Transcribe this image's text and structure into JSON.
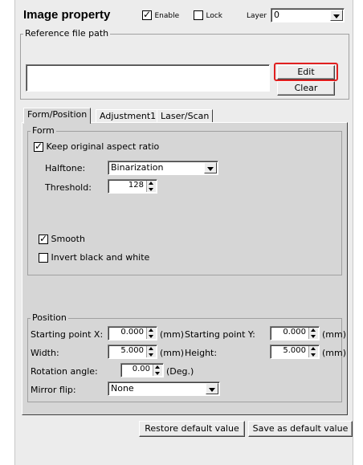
{
  "header": {
    "title": "Image property",
    "enable_label": "Enable",
    "enable_checked": true,
    "lock_label": "Lock",
    "lock_checked": false,
    "layer_label": "Layer",
    "layer_value": "0"
  },
  "reference": {
    "group_label": "Reference file path",
    "path_value": "",
    "edit_label": "Edit",
    "clear_label": "Clear"
  },
  "tabs": [
    {
      "label": "Form/Position",
      "active": true
    },
    {
      "label": "Adjustment1",
      "active": false
    },
    {
      "label": "Laser/Scan",
      "active": false
    }
  ],
  "form": {
    "group_label": "Form",
    "keep_ratio_label": "Keep original aspect ratio",
    "keep_ratio_checked": true,
    "halftone_label": "Halftone:",
    "halftone_value": "Binarization",
    "threshold_label": "Threshold:",
    "threshold_value": "128",
    "smooth_label": "Smooth",
    "smooth_checked": true,
    "invert_label": "Invert black and white",
    "invert_checked": false
  },
  "position": {
    "group_label": "Position",
    "start_x_label": "Starting point X:",
    "start_x_value": "0.000",
    "start_y_label": "Starting point Y:",
    "start_y_value": "0.000",
    "width_label": "Width:",
    "width_value": "5.000",
    "height_label": "Height:",
    "height_value": "5.000",
    "unit_mm": "(mm)",
    "rotation_label": "Rotation angle:",
    "rotation_value": "0.00",
    "unit_deg": "(Deg.)",
    "mirror_label": "Mirror flip:",
    "mirror_value": "None"
  },
  "footer": {
    "restore_label": "Restore default value",
    "save_default_label": "Save as default value"
  },
  "colors": {
    "highlight_border": "#e02020"
  }
}
